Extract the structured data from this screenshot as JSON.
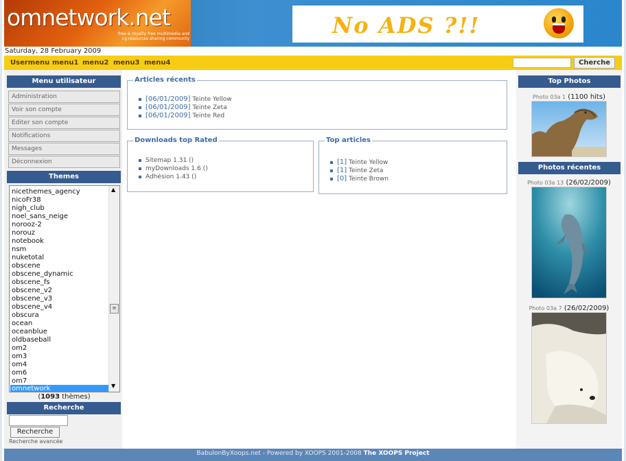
{
  "header": {
    "logo_text": "omnetwork.net",
    "logo_tagline": "free & royalty free multimedia and cg resources sharing community",
    "banner_text": "No ADS ?!!"
  },
  "date": "Saturday, 28 February 2009",
  "nav": {
    "items": [
      "Usermenu",
      "menu1",
      "menu2",
      "menu3",
      "menu4"
    ],
    "search_value": "",
    "search_button": "Cherche"
  },
  "left": {
    "user_menu_title": "Menu utilisateur",
    "user_menu_items": [
      "Administration",
      "Voir son compte",
      "Editer son compte",
      "Notifications",
      "Messages",
      "Déconnexion"
    ],
    "themes_title": "Themes",
    "themes": [
      "nicethemes_agency",
      "nicoFr38",
      "nigh_club",
      "noel_sans_neige",
      "norooz-2",
      "norouz",
      "notebook",
      "nsm",
      "nuketotal",
      "obscene",
      "obscene_dynamic",
      "obscene_fs",
      "obscene_v2",
      "obscene_v3",
      "obscene_v4",
      "obscura",
      "ocean",
      "oceanblue",
      "oldbaseball",
      "om2",
      "om3",
      "om4",
      "om6",
      "om7",
      "omnetwork"
    ],
    "selected_theme": "omnetwork",
    "theme_count_prefix": "(",
    "theme_count": "1093",
    "theme_count_suffix": " thèmes)",
    "search_title": "Recherche",
    "search_value": "",
    "search_button": "Recherche",
    "search_advanced": "Recherche avancée"
  },
  "center": {
    "recent_title": "Articles récents",
    "recent": [
      {
        "date": "[06/01/2009]",
        "title": "Teinte Yellow"
      },
      {
        "date": "[06/01/2009]",
        "title": "Teinte Zeta"
      },
      {
        "date": "[06/01/2009]",
        "title": "Teinte Red"
      }
    ],
    "downloads_title": "Downloads top Rated",
    "downloads": [
      {
        "title": "Sitemap 1.31",
        "suffix": " ()"
      },
      {
        "title": "myDownloads 1.6",
        "suffix": " ()"
      },
      {
        "title": "Adhésion 1.43",
        "suffix": " ()"
      }
    ],
    "top_title": "Top articles",
    "top": [
      {
        "count": "[1]",
        "title": "Teinte Yellow"
      },
      {
        "count": "[1]",
        "title": "Teinte Zeta"
      },
      {
        "count": "[0]",
        "title": "Teinte Brown"
      }
    ]
  },
  "right": {
    "top_photos_title": "Top Photos",
    "top_photo": {
      "name": "Photo 03a 1",
      "meta": " (1100 hits)"
    },
    "recent_title": "Photos récentes",
    "recent_photos": [
      {
        "name": "Photo 03a 13",
        "meta": " (26/02/2009)"
      },
      {
        "name": "Photo 03a 7",
        "meta": " (26/02/2009)"
      }
    ]
  },
  "footer": {
    "text": "BabulonByXoops.net - Powered by XOOPS 2001-2008 ",
    "project": "The XOOPS Project"
  },
  "colors": {
    "nav_bg": "#f7cd14",
    "block_title_bg": "#355b8f",
    "accent_blue": "#3b6ba6",
    "footer_bg": "#5b86b8",
    "logo_orange": "#e3620f"
  }
}
